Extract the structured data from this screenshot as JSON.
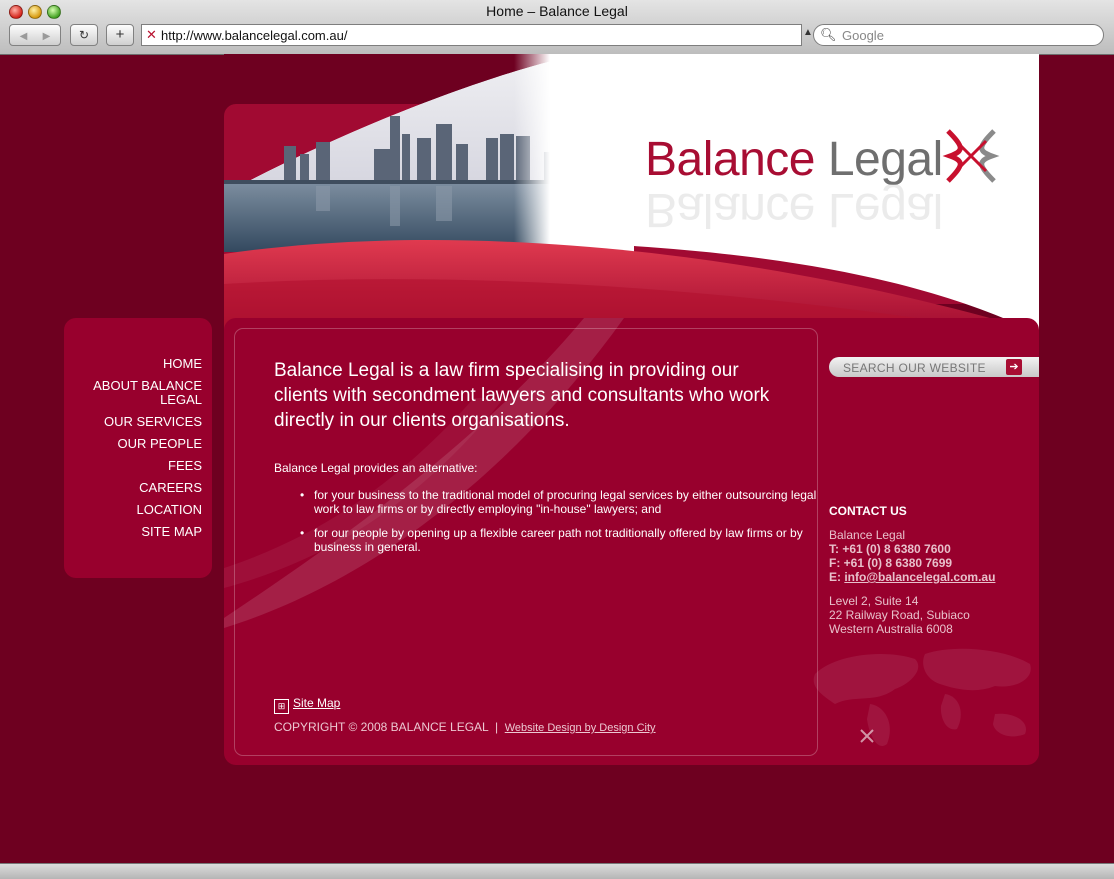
{
  "browser": {
    "title": "Home – Balance Legal",
    "url": "http://www.balancelegal.com.au/",
    "search_placeholder": "Google",
    "back_glyph": "◀",
    "forward_glyph": "▶",
    "reload_glyph": "↻",
    "add_glyph": "+"
  },
  "logo": {
    "word1": "Balance",
    "word2": "Legal"
  },
  "nav": {
    "items": [
      {
        "label": "HOME"
      },
      {
        "label": "ABOUT BALANCE LEGAL"
      },
      {
        "label": "OUR SERVICES"
      },
      {
        "label": "OUR PEOPLE"
      },
      {
        "label": "FEES"
      },
      {
        "label": "CAREERS"
      },
      {
        "label": "LOCATION"
      },
      {
        "label": "SITE MAP"
      }
    ]
  },
  "main": {
    "lead": "Balance Legal is a law firm specialising in providing our clients with secondment lawyers and consultants who work directly in our clients organisations.",
    "intro": "Balance Legal provides an alternative:",
    "bullets": [
      "for your business to the traditional model of procuring legal services by either outsourcing legal work to law firms or by directly employing \"in-house\" lawyers; and",
      "for our people by opening up a flexible career path not traditionally offered by law firms or by business in general."
    ],
    "sitemap_label": "Site Map",
    "copyright": "COPYRIGHT © 2008 BALANCE LEGAL",
    "separator": "|",
    "design_credit": "Website Design by Design City"
  },
  "sidebar": {
    "search_placeholder": "SEARCH OUR WEBSITE",
    "contact_title": "CONTACT US",
    "company": "Balance Legal",
    "phone": "T: +61 (0) 8 6380 7600",
    "fax": "F: +61 (0) 8 6380 7699",
    "email_prefix": "E: ",
    "email": "info@balancelegal.com.au",
    "address_line1": "Level 2, Suite 14",
    "address_line2": "22 Railway Road, Subiaco",
    "address_line3": "Western Australia 6008"
  },
  "colors": {
    "brand_red": "#98002d",
    "page_bg": "#6e0020",
    "accent": "#a80d33"
  }
}
